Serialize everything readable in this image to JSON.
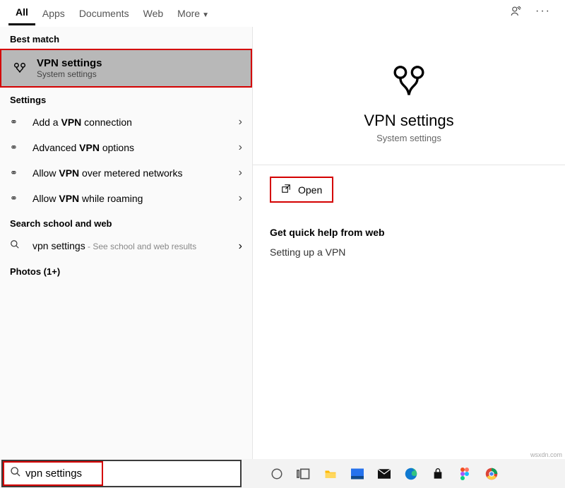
{
  "tabs": {
    "all": "All",
    "apps": "Apps",
    "documents": "Documents",
    "web": "Web",
    "more": "More"
  },
  "left": {
    "best_match_label": "Best match",
    "best_match": {
      "title": "VPN settings",
      "subtitle": "System settings"
    },
    "settings_label": "Settings",
    "items": {
      "add": {
        "pre": "Add a ",
        "bold": "VPN",
        "post": " connection"
      },
      "adv": {
        "pre": "Advanced ",
        "bold": "VPN",
        "post": " options"
      },
      "metered": {
        "pre": "Allow ",
        "bold": "VPN",
        "post": " over metered networks"
      },
      "roaming": {
        "pre": "Allow ",
        "bold": "VPN",
        "post": " while roaming"
      }
    },
    "search_web_label": "Search school and web",
    "search_web": {
      "main": "vpn settings",
      "sub": " - See school and web results"
    },
    "photos_label": "Photos (1+)"
  },
  "right": {
    "title": "VPN settings",
    "subtitle": "System settings",
    "open_label": "Open",
    "help_title": "Get quick help from web",
    "help_link": "Setting up a VPN"
  },
  "search_value": "vpn settings",
  "watermark": "wsxdn.com"
}
